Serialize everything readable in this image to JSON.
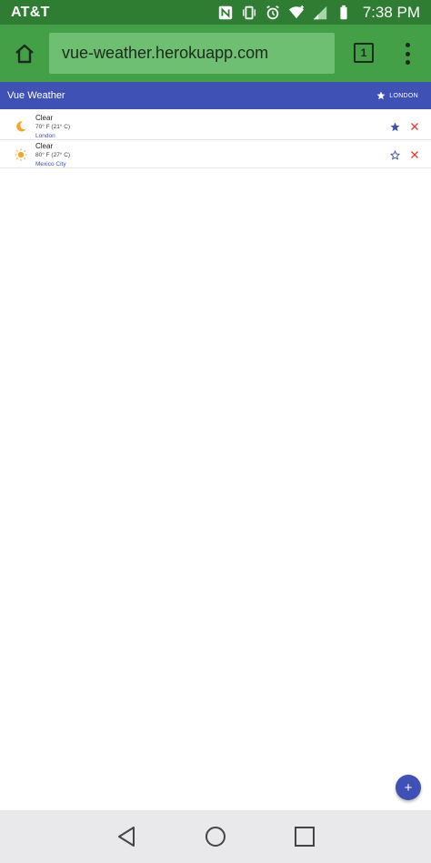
{
  "status_bar": {
    "carrier": "AT&T",
    "time": "7:38 PM"
  },
  "browser": {
    "url": "vue-weather.herokuapp.com",
    "tab_count": "1"
  },
  "app_header": {
    "title": "Vue Weather",
    "favorite_city": "LONDON"
  },
  "weather_items": [
    {
      "condition": "Clear",
      "temperature": "70° F (21° C)",
      "city": "London",
      "icon": "moon-icon",
      "favorite": true
    },
    {
      "condition": "Clear",
      "temperature": "80° F (27° C)",
      "city": "Mexico City",
      "icon": "sun-icon",
      "favorite": false
    }
  ],
  "fab": {
    "label": "+"
  },
  "colors": {
    "status_bar": "#2e7d32",
    "toolbar": "#43a047",
    "app_header": "#3f51b5",
    "delete": "#e53935",
    "icon_orange": "#f5a623"
  }
}
